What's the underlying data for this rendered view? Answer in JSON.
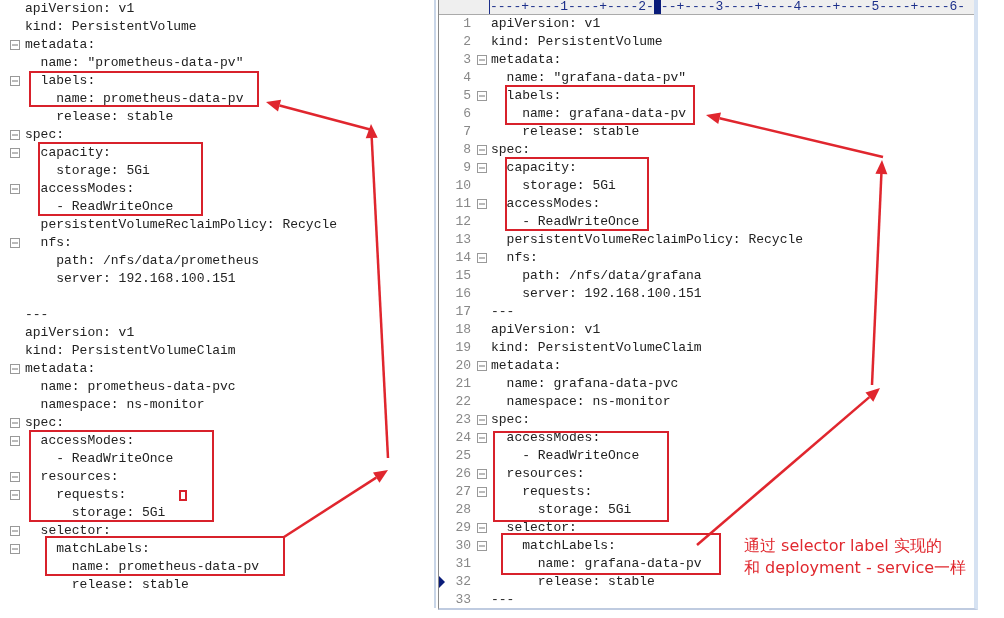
{
  "left_editor": {
    "lines": [
      {
        "text": "apiVersion: v1",
        "foldable": false
      },
      {
        "text": "kind: PersistentVolume",
        "foldable": false
      },
      {
        "text": "metadata:",
        "foldable": true
      },
      {
        "text": "  name: \"prometheus-data-pv\"",
        "foldable": false
      },
      {
        "text": "  labels:",
        "foldable": true
      },
      {
        "text": "    name: prometheus-data-pv",
        "foldable": false
      },
      {
        "text": "    release: stable",
        "foldable": false
      },
      {
        "text": "spec:",
        "foldable": true
      },
      {
        "text": "  capacity:",
        "foldable": true
      },
      {
        "text": "    storage: 5Gi",
        "foldable": false
      },
      {
        "text": "  accessModes:",
        "foldable": true
      },
      {
        "text": "    - ReadWriteOnce",
        "foldable": false
      },
      {
        "text": "  persistentVolumeReclaimPolicy: Recycle",
        "foldable": false
      },
      {
        "text": "  nfs:",
        "foldable": true
      },
      {
        "text": "    path: /nfs/data/prometheus",
        "foldable": false
      },
      {
        "text": "    server: 192.168.100.151",
        "foldable": false
      },
      {
        "foldable": false
      },
      {
        "text": "---",
        "foldable": false
      },
      {
        "text": "apiVersion: v1",
        "foldable": false
      },
      {
        "text": "kind: PersistentVolumeClaim",
        "foldable": false
      },
      {
        "text": "metadata:",
        "foldable": true
      },
      {
        "text": "  name: prometheus-data-pvc",
        "foldable": false
      },
      {
        "text": "  namespace: ns-monitor",
        "foldable": false
      },
      {
        "text": "spec:",
        "foldable": true
      },
      {
        "text": "  accessModes:",
        "foldable": true
      },
      {
        "text": "    - ReadWriteOnce",
        "foldable": false
      },
      {
        "text": "  resources:",
        "foldable": true
      },
      {
        "text": "    requests:",
        "foldable": true
      },
      {
        "text": "      storage: 5Gi",
        "foldable": false
      },
      {
        "text": "  selector:",
        "foldable": true
      },
      {
        "text": "    matchLabels:",
        "foldable": true
      },
      {
        "text": "      name: prometheus-data-pv",
        "foldable": false
      },
      {
        "text": "      release: stable",
        "foldable": false
      }
    ]
  },
  "right_editor": {
    "ruler": {
      "before": "----+----1----+----2-",
      "after": "--+----3----+----4----+----5----+----6-"
    },
    "lines": [
      {
        "number": "1",
        "text": "apiVersion: v1",
        "foldable": false,
        "current": false
      },
      {
        "number": "2",
        "text": "kind: PersistentVolume",
        "foldable": false,
        "current": false
      },
      {
        "number": "3",
        "text": "metadata:",
        "foldable": true,
        "current": false
      },
      {
        "number": "4",
        "text": "  name: \"grafana-data-pv\"",
        "foldable": false,
        "current": false
      },
      {
        "number": "5",
        "text": "  labels:",
        "foldable": true,
        "current": false
      },
      {
        "number": "6",
        "text": "    name: grafana-data-pv",
        "foldable": false,
        "current": false
      },
      {
        "number": "7",
        "text": "    release: stable",
        "foldable": false,
        "current": false
      },
      {
        "number": "8",
        "text": "spec:",
        "foldable": true,
        "current": false
      },
      {
        "number": "9",
        "text": "  capacity:",
        "foldable": true,
        "current": false
      },
      {
        "number": "10",
        "text": "    storage: 5Gi",
        "foldable": false,
        "current": false
      },
      {
        "number": "11",
        "text": "  accessModes:",
        "foldable": true,
        "current": false
      },
      {
        "number": "12",
        "text": "    - ReadWriteOnce",
        "foldable": false,
        "current": false
      },
      {
        "number": "13",
        "text": "  persistentVolumeReclaimPolicy: Recycle",
        "foldable": false,
        "current": false
      },
      {
        "number": "14",
        "text": "  nfs:",
        "foldable": true,
        "current": false
      },
      {
        "number": "15",
        "text": "    path: /nfs/data/grafana",
        "foldable": false,
        "current": false
      },
      {
        "number": "16",
        "text": "    server: 192.168.100.151",
        "foldable": false,
        "current": false
      },
      {
        "number": "17",
        "text": "---",
        "foldable": false,
        "current": false
      },
      {
        "number": "18",
        "text": "apiVersion: v1",
        "foldable": false,
        "current": false
      },
      {
        "number": "19",
        "text": "kind: PersistentVolumeClaim",
        "foldable": false,
        "current": false
      },
      {
        "number": "20",
        "text": "metadata:",
        "foldable": true,
        "current": false
      },
      {
        "number": "21",
        "text": "  name: grafana-data-pvc",
        "foldable": false,
        "current": false
      },
      {
        "number": "22",
        "text": "  namespace: ns-monitor",
        "foldable": false,
        "current": false
      },
      {
        "number": "23",
        "text": "spec:",
        "foldable": true,
        "current": false
      },
      {
        "number": "24",
        "text": "  accessModes:",
        "foldable": true,
        "current": false
      },
      {
        "number": "25",
        "text": "    - ReadWriteOnce",
        "foldable": false,
        "current": false
      },
      {
        "number": "26",
        "text": "  resources:",
        "foldable": true,
        "current": false
      },
      {
        "number": "27",
        "text": "    requests:",
        "foldable": true,
        "current": false
      },
      {
        "number": "28",
        "text": "      storage: 5Gi",
        "foldable": false,
        "current": false
      },
      {
        "number": "29",
        "text": "  selector:",
        "foldable": true,
        "current": false
      },
      {
        "number": "30",
        "text": "    matchLabels:",
        "foldable": true,
        "current": false
      },
      {
        "number": "31",
        "text": "      name: grafana-data-pv",
        "foldable": false,
        "current": false
      },
      {
        "number": "32",
        "text": "      release: stable",
        "foldable": false,
        "current": true
      },
      {
        "number": "33",
        "text": "---",
        "foldable": false,
        "current": false
      }
    ]
  },
  "annotation": {
    "lines": [
      "通过 selector label 实现的",
      "和 deployment - service一样"
    ]
  }
}
